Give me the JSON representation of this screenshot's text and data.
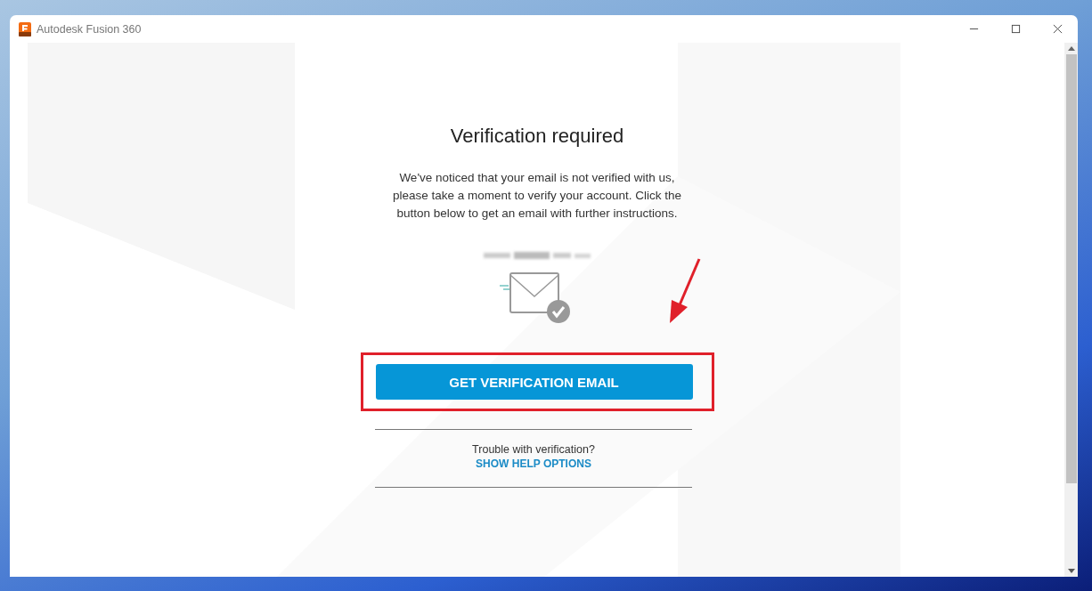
{
  "window": {
    "title": "Autodesk Fusion 360"
  },
  "heading": "Verification required",
  "message": "We've noticed that your email is not verified with us, please take a moment to verify your account. Click the button below to get an email with further instructions.",
  "primary_button": "GET VERIFICATION EMAIL",
  "help": {
    "question": "Trouble with verification?",
    "link": "SHOW HELP OPTIONS"
  }
}
